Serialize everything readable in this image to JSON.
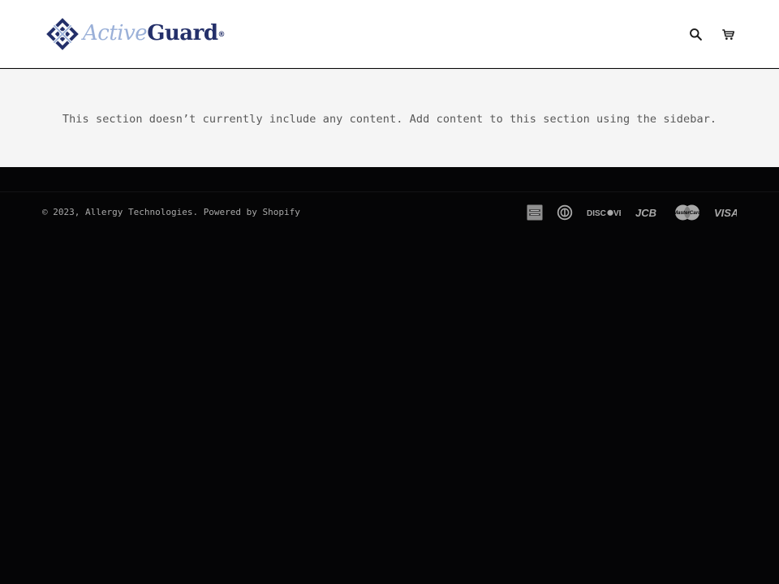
{
  "header": {
    "logo": {
      "word_active": "Active",
      "word_guard": "Guard",
      "registered": "®",
      "alt": "ActiveGuard"
    },
    "icons": {
      "search": "search-icon",
      "cart": "cart-icon"
    }
  },
  "main": {
    "empty_message": "This section doesn’t currently include any content. Add content to this section using the sidebar."
  },
  "footer": {
    "copyright_prefix": "© 2023, ",
    "company": "Allergy Technologies",
    "powered_by": "Powered by Shopify",
    "payment_icons": [
      {
        "name": "american-express-icon",
        "label": "American Express"
      },
      {
        "name": "diners-club-icon",
        "label": "Diners Club"
      },
      {
        "name": "discover-icon",
        "label": "DISCOVER"
      },
      {
        "name": "jcb-icon",
        "label": "JCB"
      },
      {
        "name": "mastercard-icon",
        "label": "MasterCard"
      },
      {
        "name": "visa-icon",
        "label": "VISA"
      }
    ]
  },
  "colors": {
    "logo_light": "#9ab0d8",
    "logo_dark": "#24306a",
    "main_bg": "#f5f5f5",
    "footer_bg": "#050506"
  }
}
